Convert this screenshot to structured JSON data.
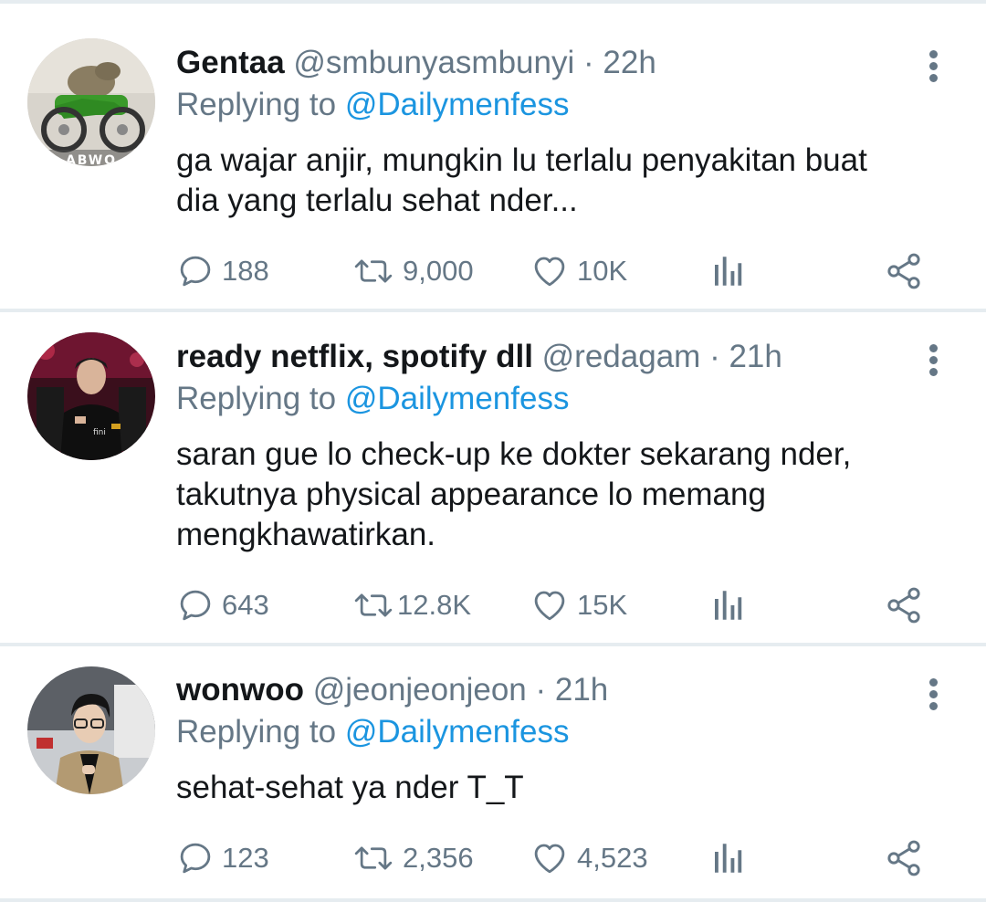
{
  "tweets": [
    {
      "name": "Gentaa",
      "handle": "@smbunyasmbunyi",
      "dot": "·",
      "time": "22h",
      "replying_prefix": "Replying to",
      "replying_to": "@Dailymenfess",
      "lines": [
        "ga wajar anjir, mungkin lu terlalu penyakitan buat",
        "dia yang terlalu sehat nder..."
      ],
      "replies": "188",
      "retweets": "9,000",
      "likes": "10K",
      "avatar_text": "ABWO"
    },
    {
      "name": "ready netflix, spotify dll",
      "handle": "@redagam",
      "dot": "·",
      "time": "21h",
      "replying_prefix": "Replying to",
      "replying_to": "@Dailymenfess",
      "lines": [
        "saran gue lo check-up ke dokter sekarang nder,",
        "takutnya physical appearance lo memang",
        "mengkhawatirkan."
      ],
      "replies": "643",
      "retweets": "12.8K",
      "likes": "15K"
    },
    {
      "name": "wonwoo",
      "handle": "@jeonjeonjeon",
      "dot": "·",
      "time": "21h",
      "replying_prefix": "Replying to",
      "replying_to": "@Dailymenfess",
      "lines": [
        "sehat-sehat ya nder T_T"
      ],
      "replies": "123",
      "retweets": "2,356",
      "likes": "4,523"
    }
  ],
  "icons": {
    "reply": "reply-icon",
    "retweet": "retweet-icon",
    "like": "heart-icon",
    "analytics": "analytics-icon",
    "share": "share-icon",
    "more": "more-vertical-icon"
  },
  "colors": {
    "text": "#14171a",
    "muted": "#657786",
    "link": "#1b95e0",
    "separator": "#e6ecf0"
  }
}
